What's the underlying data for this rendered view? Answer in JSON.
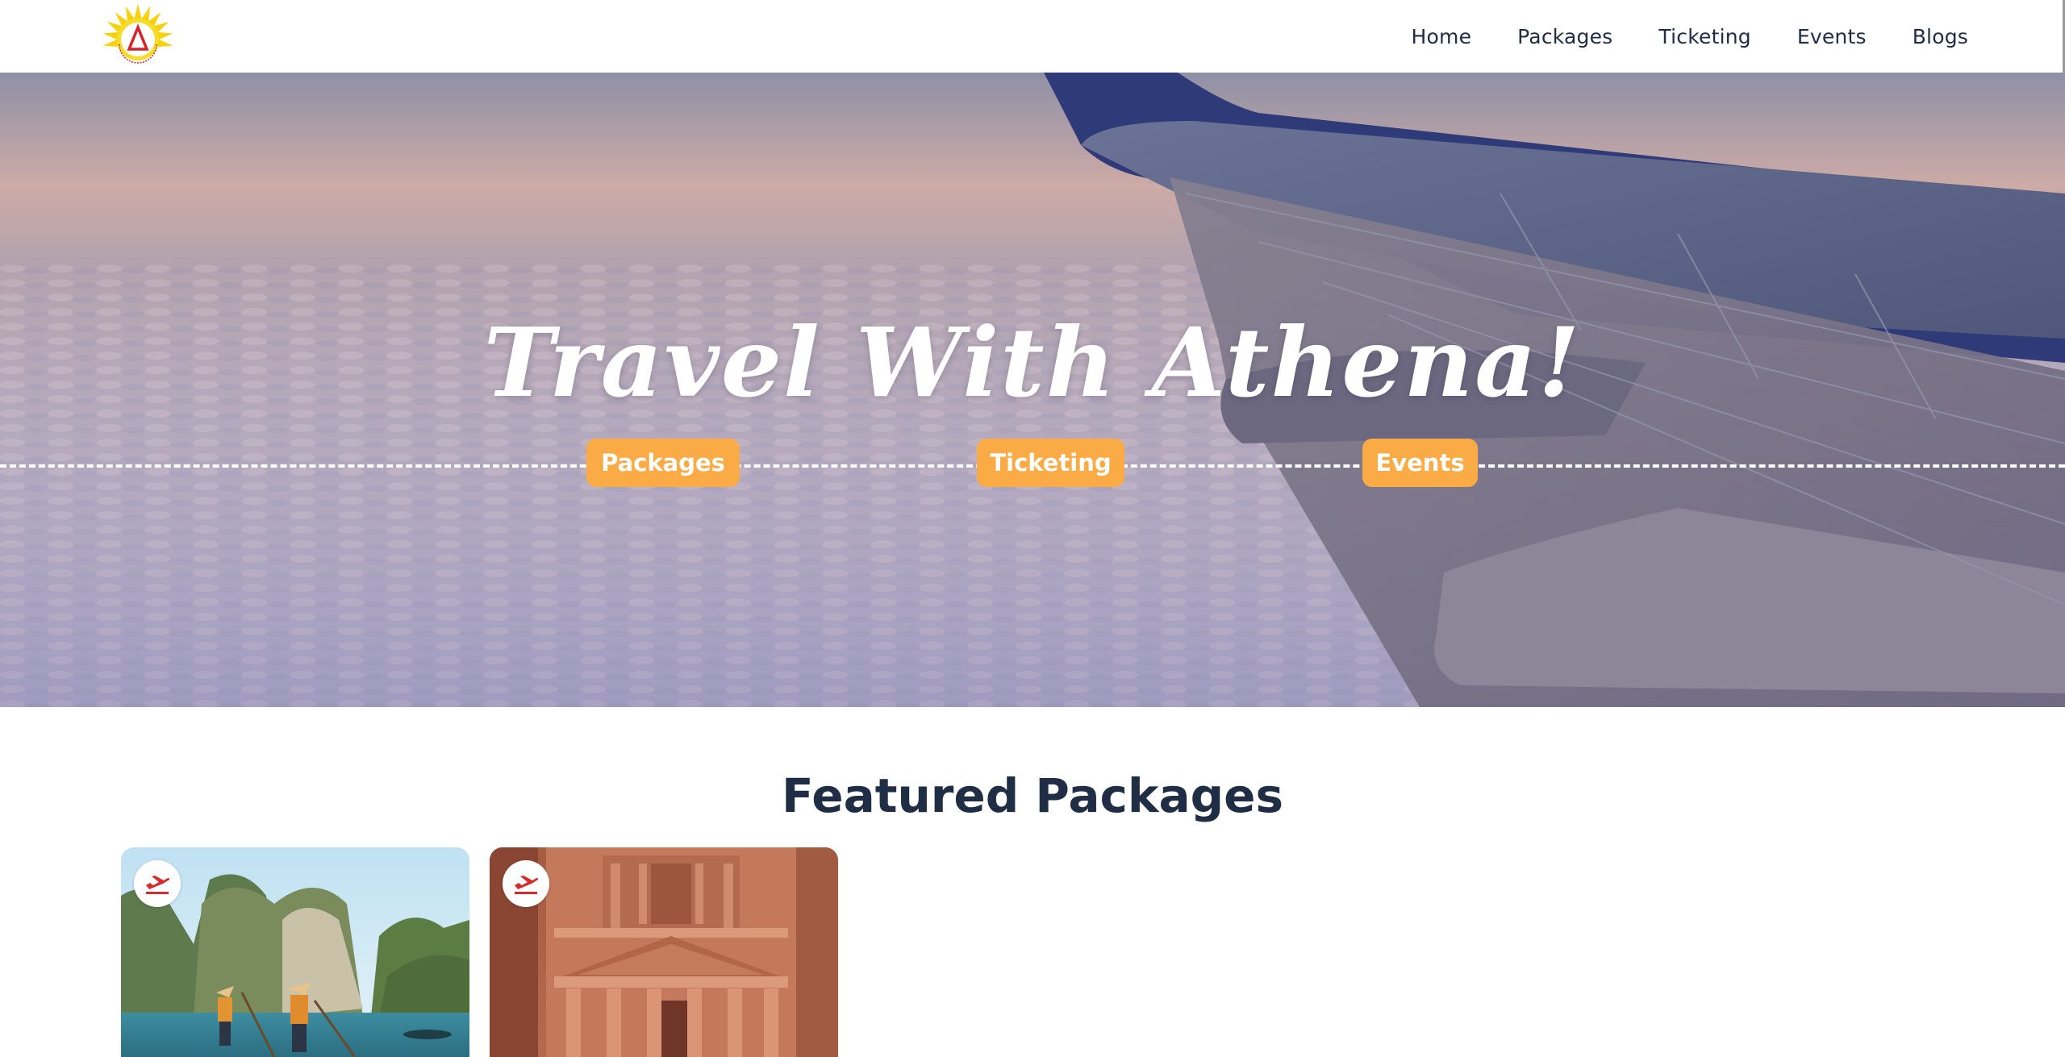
{
  "header": {
    "logo_alt": "Athena Travel Tours & Events",
    "nav": [
      {
        "label": "Home"
      },
      {
        "label": "Packages"
      },
      {
        "label": "Ticketing"
      },
      {
        "label": "Events"
      },
      {
        "label": "Blogs"
      }
    ]
  },
  "hero": {
    "title": "Travel With Athena!",
    "buttons": [
      {
        "label": "Packages"
      },
      {
        "label": "Ticketing"
      },
      {
        "label": "Events"
      }
    ]
  },
  "featured": {
    "title": "Featured Packages",
    "cards": [
      {
        "icon": "airplane-departure-icon"
      },
      {
        "icon": "airplane-departure-icon"
      }
    ]
  },
  "colors": {
    "accent": "#fbab45",
    "text": "#1f2d45",
    "badge_icon": "#d52b2b"
  }
}
